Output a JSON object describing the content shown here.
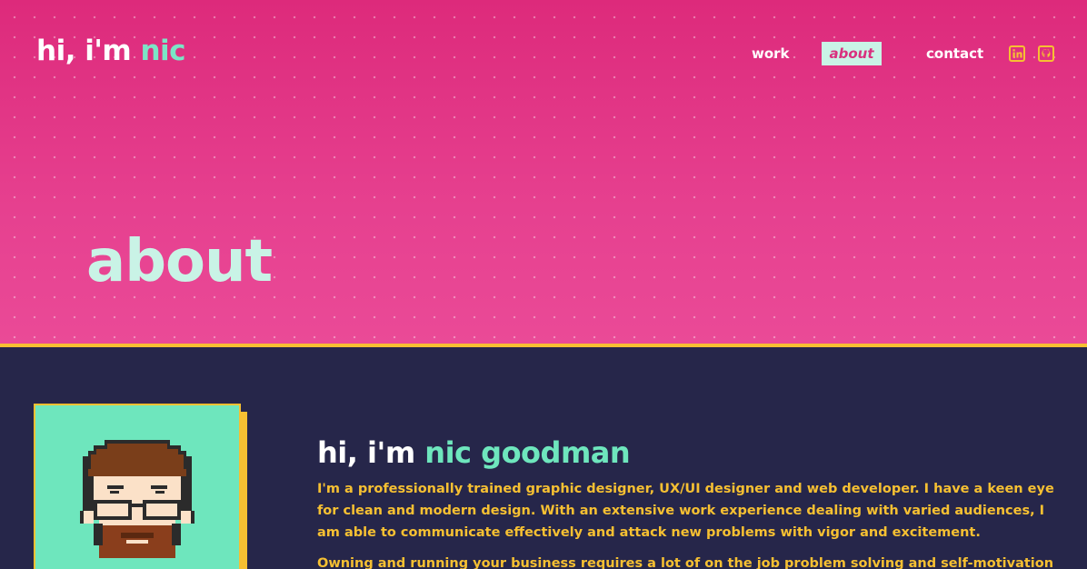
{
  "header": {
    "logo_prefix": "hi, i'm ",
    "logo_name": "nic",
    "nav": {
      "work": "work",
      "about": "about",
      "contact": "contact"
    },
    "social": [
      {
        "icon": "linkedin-icon"
      },
      {
        "icon": "github-icon"
      }
    ]
  },
  "hero": {
    "title": "about"
  },
  "bio": {
    "title_prefix": "hi, i'm ",
    "title_name": "nic goodman",
    "paragraph1": "I'm a professionally trained graphic designer, UX/UI designer and web developer. I have a keen eye for clean and modern design. With an extensive work experience dealing with varied audiences, I am able to communicate effectively and attack new problems with vigor and excitement.",
    "paragraph2": "Owning and running your business requires a lot of on the job problem solving and self-motivation when it comes"
  },
  "colors": {
    "hero_top": "#dd2a7b",
    "hero_bottom": "#ea4a97",
    "accent_mint": "#6ee6bd",
    "accent_yellow": "#f6c032",
    "content_bg": "#26264a"
  }
}
